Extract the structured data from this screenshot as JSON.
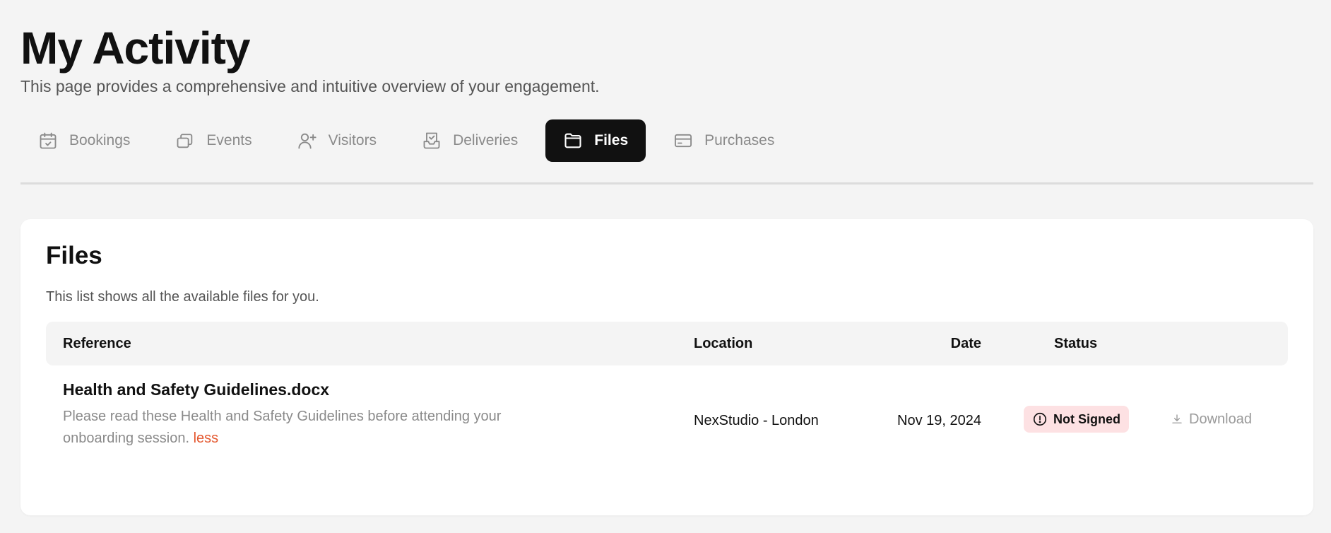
{
  "header": {
    "title": "My Activity",
    "subtitle": "This page provides a comprehensive and intuitive overview of your engagement."
  },
  "tabs": [
    {
      "label": "Bookings",
      "icon": "calendar-check-icon",
      "active": false
    },
    {
      "label": "Events",
      "icon": "ticket-stack-icon",
      "active": false
    },
    {
      "label": "Visitors",
      "icon": "user-plus-icon",
      "active": false
    },
    {
      "label": "Deliveries",
      "icon": "inbox-tray-icon",
      "active": false
    },
    {
      "label": "Files",
      "icon": "folder-icon",
      "active": true
    },
    {
      "label": "Purchases",
      "icon": "credit-card-icon",
      "active": false
    }
  ],
  "files_card": {
    "title": "Files",
    "subtitle": "This list shows all the available files for you.",
    "columns": {
      "reference": "Reference",
      "location": "Location",
      "date": "Date",
      "status": "Status"
    },
    "rows": [
      {
        "reference": "Health and Safety Guidelines.docx",
        "description": "Please read these Health and Safety Guidelines before attending your onboarding session.",
        "toggle_label": "less",
        "location": "NexStudio - London",
        "date": "Nov 19, 2024",
        "status": "Not Signed",
        "action_label": "Download"
      }
    ]
  },
  "colors": {
    "background": "#f4f4f4",
    "active_tab": "#111111",
    "accent_link": "#e4572e",
    "status_badge_bg": "#fde1e3",
    "muted_text": "#8a8a8a"
  }
}
